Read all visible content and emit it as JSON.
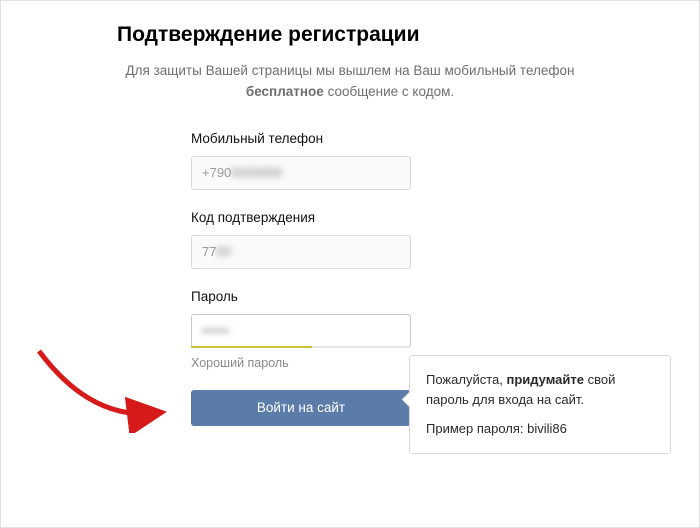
{
  "title": "Подтверждение регистрации",
  "subtext_prefix": "Для защиты Вашей страницы мы вышлем на Ваш мобильный телефон ",
  "subtext_bold": "бесплатное",
  "subtext_suffix": " сообщение с кодом.",
  "phone": {
    "label": "Мобильный телефон",
    "value_visible_prefix": "+790",
    "value_masked_rest": "0000000"
  },
  "code": {
    "label": "Код подтверждения",
    "value_visible_prefix": "77",
    "value_masked_rest": "00"
  },
  "password": {
    "label": "Пароль",
    "value_masked": "••••••",
    "strength_label": "Хороший пароль",
    "strength_percent": 55
  },
  "submit_label": "Войти на сайт",
  "hint": {
    "line_prefix": "Пожалуйста, ",
    "line_bold": "придумайте",
    "line_suffix": " свой пароль для входа на сайт.",
    "example_prefix": "Пример пароля: ",
    "example_value": "bivili86"
  },
  "colors": {
    "button_bg": "#5b7ca9",
    "strength_fill": "#c9c33a"
  }
}
